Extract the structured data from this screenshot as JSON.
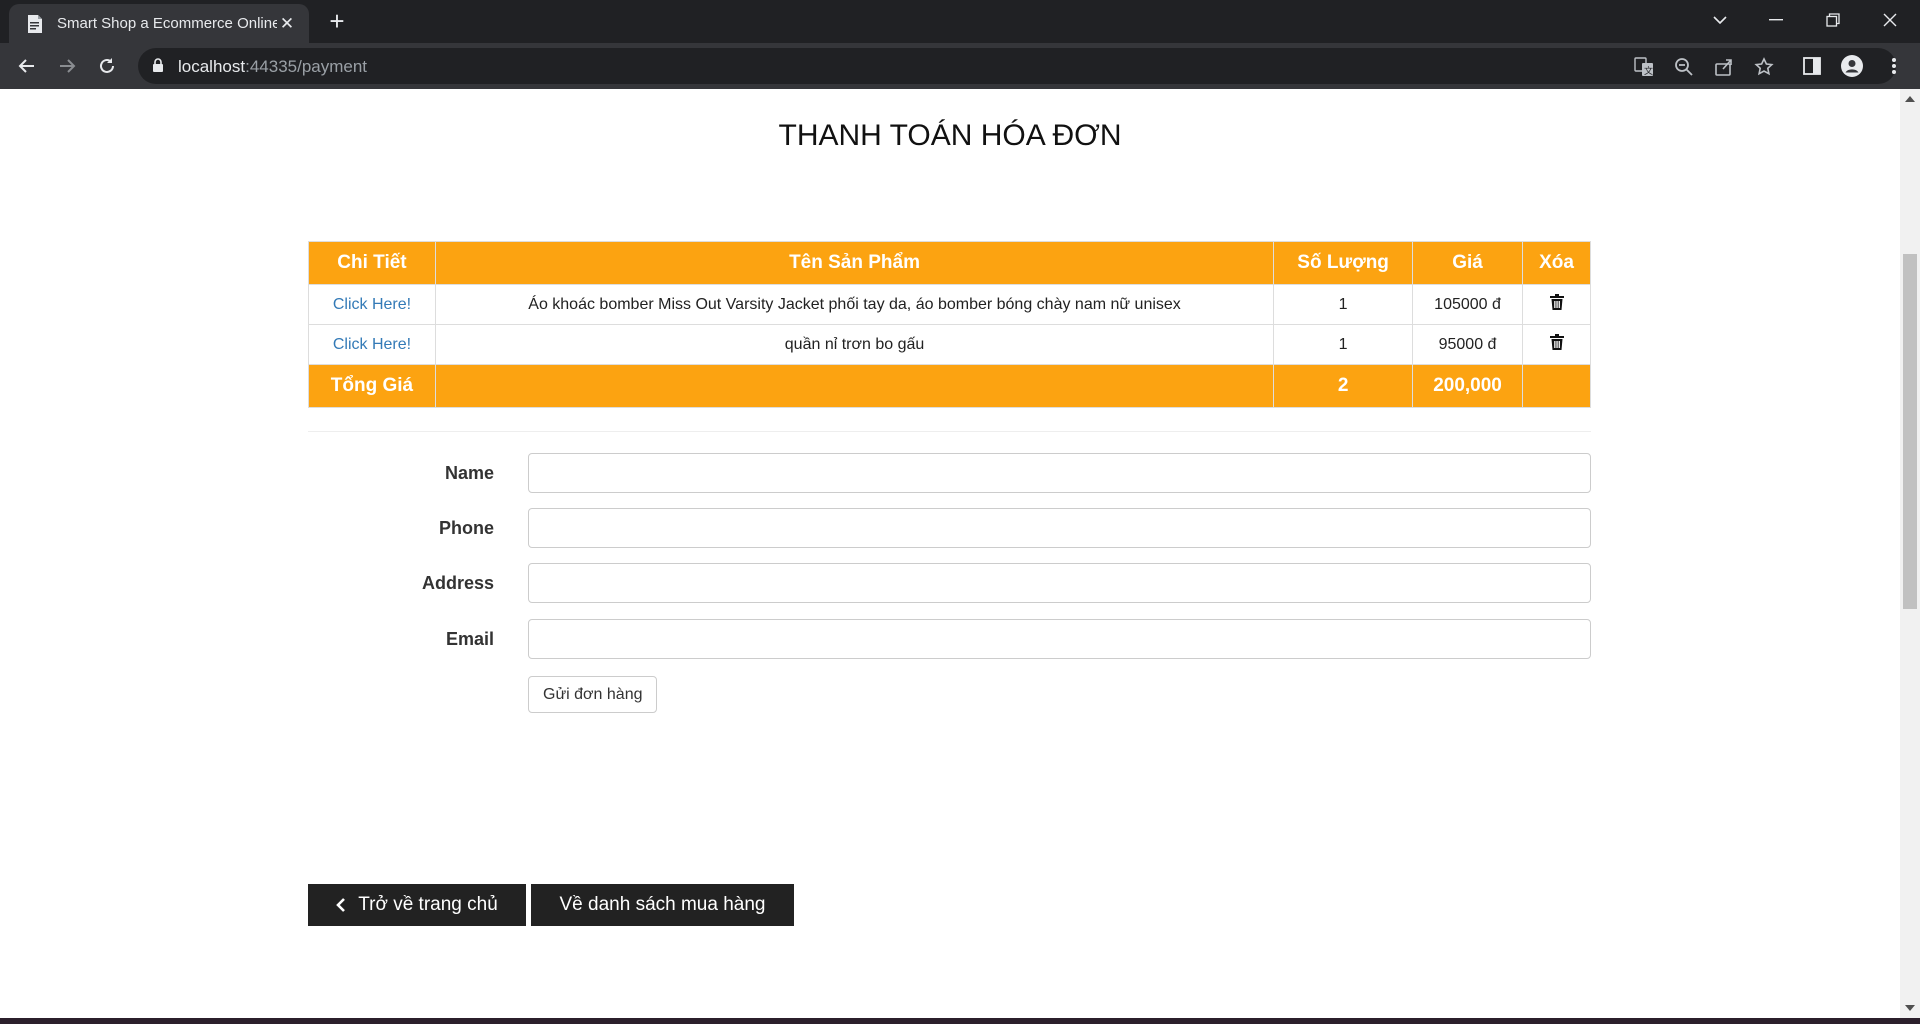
{
  "browser": {
    "tab_title": "Smart Shop a Ecommerce Online",
    "url_host": "localhost",
    "url_rest": ":44335/payment"
  },
  "page": {
    "title": "THANH TOÁN HÓA ĐƠN"
  },
  "cart": {
    "headers": [
      "Chi Tiết",
      "Tên Sản Phẩm",
      "Số Lượng",
      "Giá",
      "Xóa"
    ],
    "rows": [
      {
        "link": "Click Here!",
        "name": "Áo khoác bomber Miss Out Varsity Jacket phối tay da, áo bomber bóng chày nam nữ unisex",
        "qty": "1",
        "price": "105000 đ"
      },
      {
        "link": "Click Here!",
        "name": "quần nỉ trơn bo gấu",
        "qty": "1",
        "price": "95000 đ"
      }
    ],
    "total": {
      "label": "Tổng Giá",
      "qty": "2",
      "price": "200,000"
    }
  },
  "form": {
    "name_label": "Name",
    "phone_label": "Phone",
    "address_label": "Address",
    "email_label": "Email",
    "submit_label": "Gửi đơn hàng"
  },
  "buttons": {
    "home_label": "Trở về trang chủ",
    "list_label": "Về danh sách mua hàng"
  },
  "colors": {
    "accent": "#fca311",
    "dark_button": "#222222",
    "link": "#337ab7"
  }
}
